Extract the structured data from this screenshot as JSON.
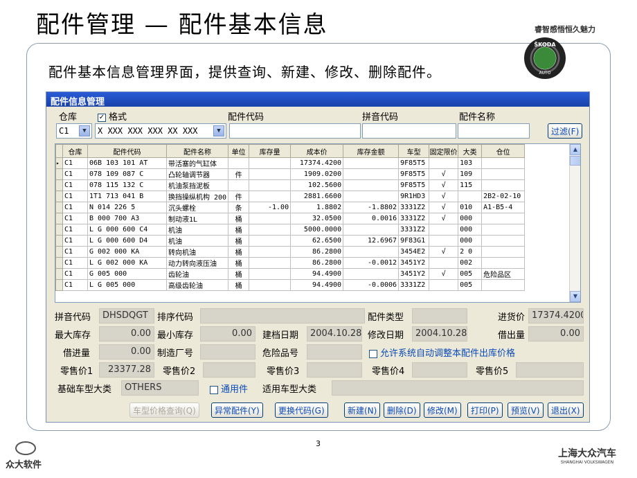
{
  "slide": {
    "title": "配件管理 — 配件基本信息",
    "slogan": "睿智感悟恒久魅力",
    "intro": "配件基本信息管理界面，提供查询、新建、修改、删除配件。",
    "logo_top": "ŠKODA",
    "logo_bottom": "AUTO",
    "page": "3",
    "footer_left": "众大软件",
    "footer_right": "上海大众汽车",
    "footer_right_sub": "SHANGHAI VOLKSWAGEN"
  },
  "window": {
    "title": "配件信息管理",
    "filter": {
      "warehouse_label": "仓库",
      "format_label": "格式",
      "format_checked": "✓",
      "code_label": "配件代码",
      "pinyin_label": "拼音代码",
      "name_label": "配件名称",
      "warehouse_value": "C1",
      "format_value": "X XXX XXX XXX XX XXX",
      "code_value": "",
      "pinyin_value": "",
      "name_value": "",
      "filter_button": "过滤(F)"
    },
    "grid": {
      "headers": [
        "仓库",
        "配件代码",
        "配件名称",
        "单位",
        "库存量",
        "成本价",
        "库存金额",
        "车型",
        "固定限价",
        "大类",
        "仓位"
      ],
      "rows": [
        [
          "C1",
          "06B 103 101 AT",
          "带活塞的气缸体",
          "",
          "",
          "17374.4200",
          "",
          "9F85T5",
          "",
          "103",
          ""
        ],
        [
          "C1",
          "078 109 087 C",
          "凸轮轴调节器",
          "件",
          "",
          "1909.0200",
          "",
          "9F85T5",
          "√",
          "109",
          ""
        ],
        [
          "C1",
          "078 115 132 C",
          "机油泵挡泥板",
          "",
          "",
          "102.5600",
          "",
          "9F85T5",
          "√",
          "115",
          ""
        ],
        [
          "C1",
          "1T1 713 041 B",
          "换挡操纵机构 200",
          "件",
          "",
          "2881.6600",
          "",
          "9R1HD3",
          "√",
          "",
          "2B2-02-10"
        ],
        [
          "C1",
          "N  014 226 5",
          "沉头螺栓",
          "条",
          "-1.00",
          "1.8802",
          "-1.8802",
          "3331Z2",
          "√",
          "010",
          "A1-B5-4"
        ],
        [
          "C1",
          "B  000 700 A3",
          "制动液1L",
          "桶",
          "",
          "32.0500",
          "0.0016",
          "3331Z2",
          "√",
          "000",
          ""
        ],
        [
          "C1",
          "L G  000 600 C4",
          "机油",
          "桶",
          "",
          "5000.0000",
          "",
          "3331Z2",
          "",
          "000",
          ""
        ],
        [
          "C1",
          "L G  000 600 D4",
          "机油",
          "桶",
          "",
          "62.6500",
          "12.6967",
          "9F83G1",
          "",
          "000",
          ""
        ],
        [
          "C1",
          "G  002 000 KA",
          "转向机油",
          "桶",
          "",
          "86.2800",
          "",
          "3454E2",
          "√",
          "2 0",
          ""
        ],
        [
          "C1",
          "L G  002 000 KA",
          "动力转向液压油",
          "桶",
          "",
          "86.2800",
          "-0.0012",
          "3451Y2",
          "",
          "002",
          ""
        ],
        [
          "C1",
          "G  005 000",
          "齿轮油",
          "桶",
          "",
          "94.4900",
          "",
          "3451Y2",
          "√",
          "005",
          "危险品区"
        ],
        [
          "C1",
          "L G  005 000",
          "高级齿轮油",
          "桶",
          "",
          "94.4900",
          "-0.0006",
          "3331Z2",
          "",
          "005",
          ""
        ]
      ]
    },
    "detail": {
      "pinyin_label": "拼音代码",
      "pinyin_value": "DHSDQGT",
      "sort_label": "排序代码",
      "sort_value": "",
      "type_label": "配件类型",
      "type_value": "",
      "purchase_label": "进货价",
      "purchase_value": "17374.4200",
      "max_label": "最大库存",
      "max_value": "0.00",
      "min_label": "最小库存",
      "min_value": "0.00",
      "created_label": "建档日期",
      "created_value": "2004.10.28",
      "modified_label": "修改日期",
      "modified_value": "2004.10.28",
      "borrow_out_label": "借出量",
      "borrow_out_value": "0.00",
      "borrow_in_label": "借进量",
      "borrow_in_value": "0.00",
      "mfr_label": "制造厂号",
      "mfr_value": "",
      "danger_label": "危险品号",
      "danger_value": "",
      "auto_adjust_label": "允许系统自动调整本配件出库价格",
      "retail1_label": "零售价1",
      "retail1_value": "23377.28",
      "retail2_label": "零售价2",
      "retail2_value": "",
      "retail3_label": "零售价3",
      "retail3_value": "",
      "retail4_label": "零售价4",
      "retail4_value": "",
      "retail5_label": "零售价5",
      "retail5_value": "",
      "base_model_label": "基础车型大类",
      "base_model_value": "OTHERS",
      "universal_label": "通用件",
      "universal_model_label": "适用车型大类",
      "universal_model_value": ""
    },
    "buttons": {
      "model_price": "车型价格查询(Q)",
      "abnormal": "异常配件(Y)",
      "replace_code": "更换代码(G)",
      "new": "新建(N)",
      "delete": "删除(D)",
      "modify": "修改(M)",
      "print": "打印(P)",
      "preview": "预览(V)",
      "exit": "退出(X)"
    }
  }
}
